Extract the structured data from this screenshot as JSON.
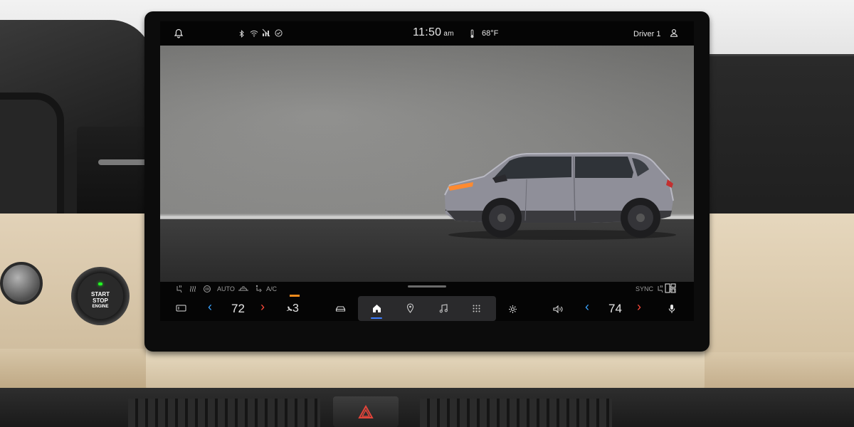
{
  "status_bar": {
    "time": "11:50",
    "ampm": "am",
    "outside_temp": "68°F",
    "driver_name": "Driver 1",
    "icons": [
      "bell-icon",
      "bluetooth-icon",
      "wifi-icon",
      "no-signal-icon",
      "check-circle-icon",
      "thermometer-icon",
      "user-icon"
    ]
  },
  "climate_options": {
    "auto_label": "AUTO",
    "ac_label": "A/C",
    "sync_label": "SYNC"
  },
  "climate": {
    "driver_temp": "72",
    "passenger_temp": "74",
    "fan_level": "3"
  },
  "nav": {
    "items": [
      "car-icon",
      "home-icon",
      "location-pin-icon",
      "music-icon",
      "apps-grid-icon"
    ],
    "active": "home"
  },
  "hardware": {
    "start_line1": "START",
    "start_line2": "STOP",
    "start_line3": "ENGINE"
  },
  "colors": {
    "accent_blue": "#3d7dff",
    "temp_down": "#3aa4ff",
    "temp_up": "#ff4a3a",
    "fan_indicator": "#f08a1c",
    "start_led": "#22ff22"
  }
}
